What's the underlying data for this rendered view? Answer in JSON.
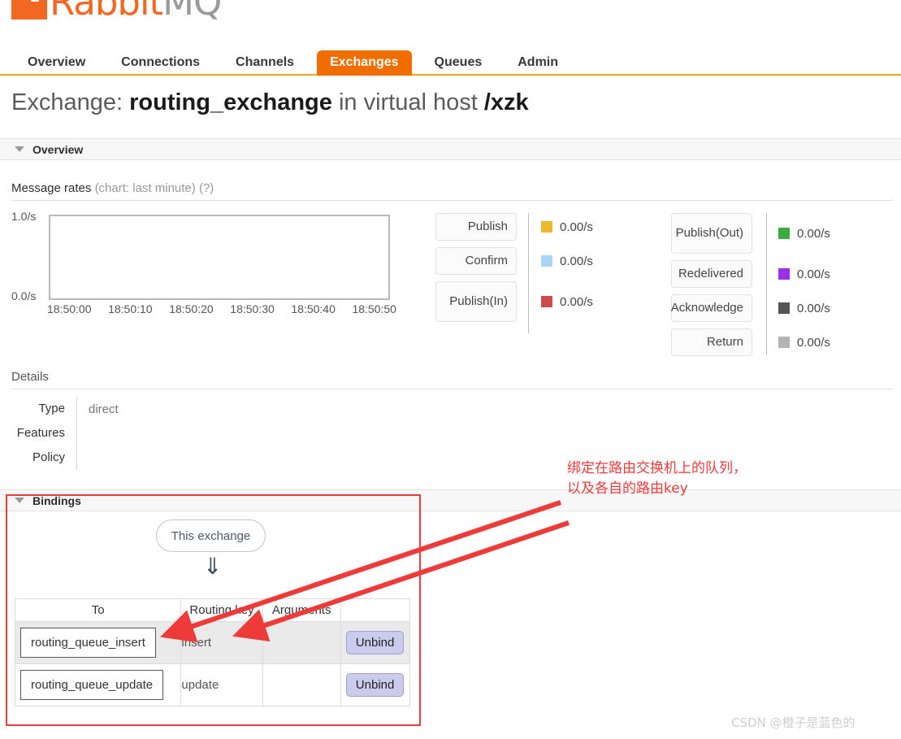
{
  "brand": {
    "name_orange": "Rabbit",
    "name_grey": "MQ",
    "tm": "™"
  },
  "nav": {
    "items": [
      {
        "label": "Overview",
        "active": false
      },
      {
        "label": "Connections",
        "active": false
      },
      {
        "label": "Channels",
        "active": false
      },
      {
        "label": "Exchanges",
        "active": true
      },
      {
        "label": "Queues",
        "active": false
      },
      {
        "label": "Admin",
        "active": false
      }
    ]
  },
  "page_title": {
    "prefix": "Exchange: ",
    "exchange_name": "routing_exchange",
    "middle": " in virtual host ",
    "vhost": "/xzk"
  },
  "overview_section": {
    "title": "Overview",
    "message_rates_label": "Message rates",
    "message_rates_sub": "(chart: last minute)",
    "help_link": "(?)"
  },
  "chart_data": {
    "type": "line",
    "title": "Message rates (chart: last minute)",
    "xlabel": "",
    "ylabel": "",
    "ylim": [
      0.0,
      1.0
    ],
    "ytick_labels": [
      "1.0/s",
      "0.0/s"
    ],
    "xtick_labels": [
      "18:50:00",
      "18:50:10",
      "18:50:20",
      "18:50:30",
      "18:50:40",
      "18:50:50"
    ],
    "grid": false,
    "legend_position": "right",
    "series": [
      {
        "name": "Publish",
        "color": "#EDB92E",
        "value": "0.00/s",
        "values": [
          0,
          0,
          0,
          0,
          0,
          0
        ]
      },
      {
        "name": "Confirm",
        "color": "#A9D5F5",
        "value": "0.00/s",
        "values": [
          0,
          0,
          0,
          0,
          0,
          0
        ]
      },
      {
        "name": "Publish (In)",
        "color": "#CC4B4B",
        "value": "0.00/s",
        "values": [
          0,
          0,
          0,
          0,
          0,
          0
        ]
      },
      {
        "name": "Publish (Out)",
        "color": "#3CAA3C",
        "value": "0.00/s",
        "values": [
          0,
          0,
          0,
          0,
          0,
          0
        ]
      },
      {
        "name": "Redelivered",
        "color": "#9B30E8",
        "value": "0.00/s",
        "values": [
          0,
          0,
          0,
          0,
          0,
          0
        ]
      },
      {
        "name": "Acknowledge",
        "color": "#555555",
        "value": "0.00/s",
        "values": [
          0,
          0,
          0,
          0,
          0,
          0
        ]
      },
      {
        "name": "Return",
        "color": "#B3B3B3",
        "value": "0.00/s",
        "values": [
          0,
          0,
          0,
          0,
          0,
          0
        ]
      }
    ]
  },
  "stats_left": [
    {
      "label": "Publish",
      "value": "0.00/s",
      "color": "#EDB92E",
      "tall": false
    },
    {
      "label": "Confirm",
      "value": "0.00/s",
      "color": "#A9D5F5",
      "tall": false
    },
    {
      "label": "Publish\n(In)",
      "value": "0.00/s",
      "color": "#CC4B4B",
      "tall": true
    }
  ],
  "stats_right": [
    {
      "label": "Publish\n(Out)",
      "value": "0.00/s",
      "color": "#3CAA3C",
      "tall": true
    },
    {
      "label": "Redelivered",
      "value": "0.00/s",
      "color": "#9B30E8",
      "tall": false
    },
    {
      "label": "Acknowledge",
      "value": "0.00/s",
      "color": "#555555",
      "tall": false
    },
    {
      "label": "Return",
      "value": "0.00/s",
      "color": "#B3B3B3",
      "tall": false
    }
  ],
  "details": {
    "heading": "Details",
    "rows": [
      {
        "key": "Type",
        "value": "direct"
      },
      {
        "key": "Features",
        "value": ""
      },
      {
        "key": "Policy",
        "value": ""
      }
    ]
  },
  "bindings": {
    "title": "Bindings",
    "source_label": "This exchange",
    "arrow_glyph": "⇓",
    "columns": [
      "To",
      "Routing key",
      "Arguments",
      ""
    ],
    "rows": [
      {
        "to": "routing_queue_insert",
        "routing_key": "insert",
        "arguments": "",
        "action": "Unbind"
      },
      {
        "to": "routing_queue_update",
        "routing_key": "update",
        "arguments": "",
        "action": "Unbind"
      }
    ]
  },
  "annotation": {
    "line1": "绑定在路由交换机上的队列，",
    "line2": "以及各自的路由key",
    "color": "#ef3a3a"
  },
  "watermark": {
    "text": "CSDN @橙子是蓝色的"
  }
}
